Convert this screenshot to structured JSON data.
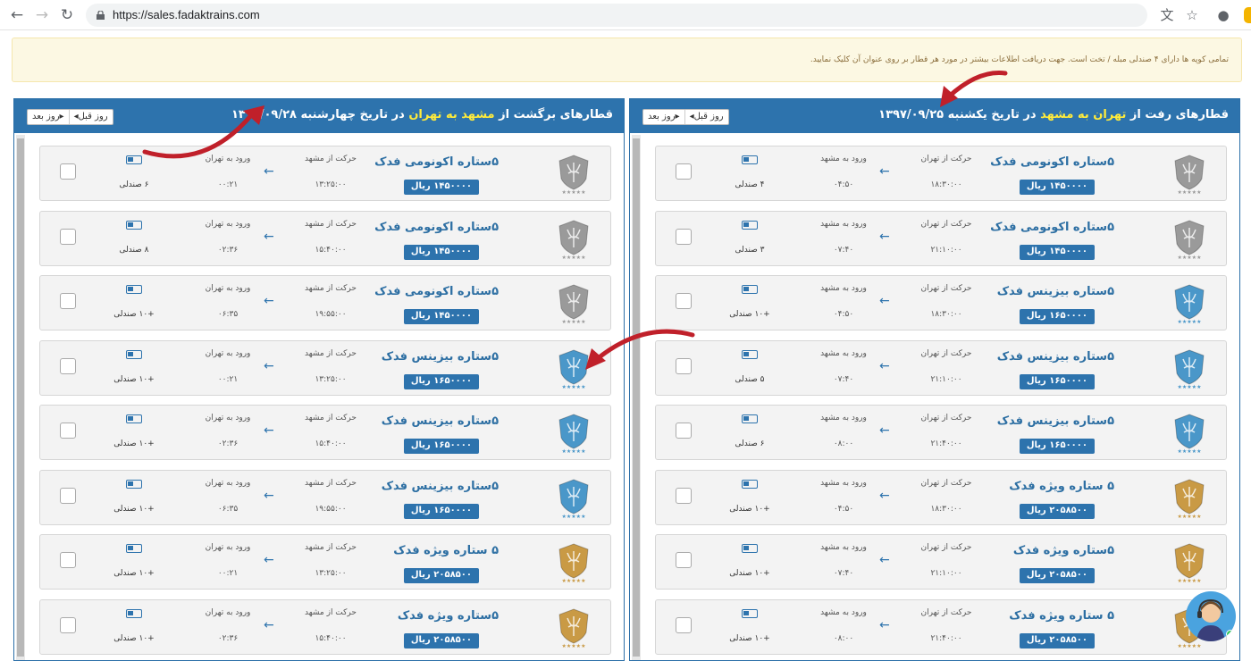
{
  "browser": {
    "url": "https://sales.fadaktrains.com"
  },
  "notice": {
    "text": "تمامی کوپه ها دارای ۴ صندلی مبله / تخت است. جهت دریافت اطلاعات بیشتر در مورد هر قطار بر روی عنوان آن کلیک نمایید."
  },
  "panels": {
    "outbound": {
      "title_prefix": "قطارهای رفت از ",
      "route": "تهران به مشهد",
      "title_suffix": " در تاریخ یکشنبه ۱۳۹۷/۰۹/۲۵",
      "prev_label": "◂روز قبل",
      "next_label": "روز بعد▸",
      "dep_label": "حرکت از تهران",
      "arr_label": "ورود به مشهد",
      "trains": [
        {
          "name": "۵ستاره اکونومی فدک",
          "price": "۱۴۵۰۰۰۰ ریال",
          "dep": "۱۸:۳۰:۰۰",
          "arr": "۰۴:۵۰",
          "seats": "۴ صندلی",
          "tier": "silver"
        },
        {
          "name": "۵ستاره اکونومی فدک",
          "price": "۱۴۵۰۰۰۰ ریال",
          "dep": "۲۱:۱۰:۰۰",
          "arr": "۰۷:۴۰",
          "seats": "۳ صندلی",
          "tier": "silver"
        },
        {
          "name": "۵ستاره بیزینس فدک",
          "price": "۱۶۵۰۰۰۰ ریال",
          "dep": "۱۸:۳۰:۰۰",
          "arr": "۰۴:۵۰",
          "seats": "+۱۰ صندلی",
          "tier": "blue"
        },
        {
          "name": "۵ستاره بیزینس فدک",
          "price": "۱۶۵۰۰۰۰ ریال",
          "dep": "۲۱:۱۰:۰۰",
          "arr": "۰۷:۴۰",
          "seats": "۵ صندلی",
          "tier": "blue"
        },
        {
          "name": "۵ستاره بیزینس فدک",
          "price": "۱۶۵۰۰۰۰ ریال",
          "dep": "۲۱:۴۰:۰۰",
          "arr": "۰۸:۰۰",
          "seats": "۶ صندلی",
          "tier": "blue"
        },
        {
          "name": "۵ ستاره ویژه فدک",
          "price": "۲۰۵۸۵۰۰ ریال",
          "dep": "۱۸:۳۰:۰۰",
          "arr": "۰۴:۵۰",
          "seats": "+۱۰ صندلی",
          "tier": "gold"
        },
        {
          "name": "۵ستاره ویژه فدک",
          "price": "۲۰۵۸۵۰۰ ریال",
          "dep": "۲۱:۱۰:۰۰",
          "arr": "۰۷:۴۰",
          "seats": "+۱۰ صندلی",
          "tier": "gold"
        },
        {
          "name": "۵ ستاره ویژه فدک",
          "price": "۲۰۵۸۵۰۰ ریال",
          "dep": "۲۱:۴۰:۰۰",
          "arr": "۰۸:۰۰",
          "seats": "+۱۰ صندلی",
          "tier": "gold"
        }
      ]
    },
    "return": {
      "title_prefix": "قطارهای برگشت از ",
      "route": "مشهد به تهران",
      "title_suffix": " در تاریخ چهارشنبه ۱۳۹۷/۰۹/۲۸",
      "prev_label": "◂روز قبل",
      "next_label": "روز بعد▸",
      "dep_label": "حرکت از مشهد",
      "arr_label": "ورود به تهران",
      "trains": [
        {
          "name": "۵ستاره اکونومی فدک",
          "price": "۱۴۵۰۰۰۰ ریال",
          "dep": "۱۳:۲۵:۰۰",
          "arr": "۰۰:۲۱",
          "seats": "۶ صندلی",
          "tier": "silver"
        },
        {
          "name": "۵ستاره اکونومی فدک",
          "price": "۱۴۵۰۰۰۰ ریال",
          "dep": "۱۵:۴۰:۰۰",
          "arr": "۰۲:۳۶",
          "seats": "۸ صندلی",
          "tier": "silver"
        },
        {
          "name": "۵ستاره اکونومی فدک",
          "price": "۱۴۵۰۰۰۰ ریال",
          "dep": "۱۹:۵۵:۰۰",
          "arr": "۰۶:۳۵",
          "seats": "+۱۰ صندلی",
          "tier": "silver"
        },
        {
          "name": "۵ستاره بیزینس فدک",
          "price": "۱۶۵۰۰۰۰ ریال",
          "dep": "۱۳:۲۵:۰۰",
          "arr": "۰۰:۲۱",
          "seats": "+۱۰ صندلی",
          "tier": "blue"
        },
        {
          "name": "۵ستاره بیزینس فدک",
          "price": "۱۶۵۰۰۰۰ ریال",
          "dep": "۱۵:۴۰:۰۰",
          "arr": "۰۲:۳۶",
          "seats": "+۱۰ صندلی",
          "tier": "blue"
        },
        {
          "name": "۵ستاره بیزینس فدک",
          "price": "۱۶۵۰۰۰۰ ریال",
          "dep": "۱۹:۵۵:۰۰",
          "arr": "۰۶:۳۵",
          "seats": "+۱۰ صندلی",
          "tier": "blue"
        },
        {
          "name": "۵ ستاره ویژه فدک",
          "price": "۲۰۵۸۵۰۰ ریال",
          "dep": "۱۳:۲۵:۰۰",
          "arr": "۰۰:۲۱",
          "seats": "+۱۰ صندلی",
          "tier": "gold"
        },
        {
          "name": "۵ستاره ویژه فدک",
          "price": "۲۰۵۸۵۰۰ ریال",
          "dep": "۱۵:۴۰:۰۰",
          "arr": "۰۲:۳۶",
          "seats": "+۱۰ صندلی",
          "tier": "gold"
        }
      ]
    }
  },
  "tier_colors": {
    "silver": "#9a9a9a",
    "blue": "#4a97c9",
    "gold": "#c99a45"
  },
  "accent": "#2d73ad",
  "annotation_color": "#c0202a"
}
